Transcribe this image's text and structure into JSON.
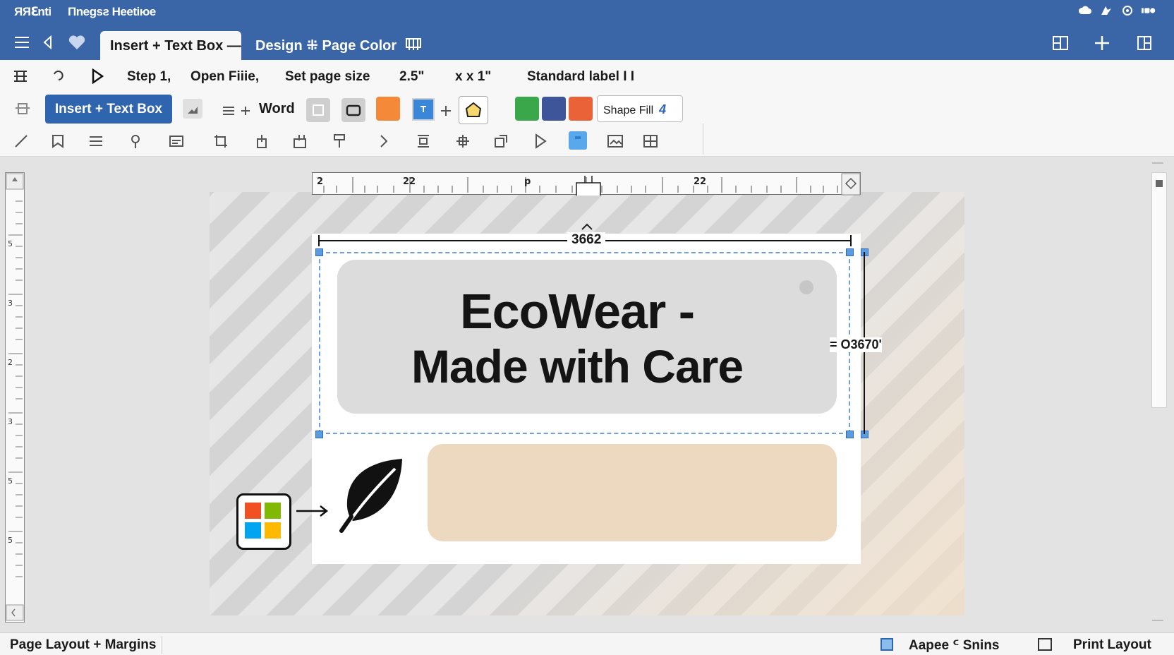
{
  "titlebar": {
    "app_name": "ЯЯℇnti",
    "document_title": "Πnegsƨ Heetiюe"
  },
  "tabs": [
    {
      "label": "Insert + Text Box —"
    },
    {
      "label": "Design ⁜ Page Color"
    }
  ],
  "steps": {
    "step1": "Step 1,",
    "step2": "Open Fiiie,",
    "step3": "Set page size",
    "size_w": "2.5\"",
    "size_h": "x x 1\"",
    "label_type": "Standard label I I"
  },
  "ribbon": {
    "insert_button": "Insert + Text Box",
    "word_label": "Word",
    "shape_fill_label": "Shape Fill",
    "shape_fill_value": "4",
    "colors": {
      "orange": "#f5893a",
      "blue": "#3a86d8",
      "green": "#3aa84a",
      "navy": "#3e5599",
      "red": "#ea6238"
    }
  },
  "ruler": {
    "marks": [
      "2",
      "22",
      "p",
      "22"
    ]
  },
  "label": {
    "headline_line1": "EcoWear -",
    "headline_line2": "Made with Care",
    "width_dim": "3662",
    "height_dim": "= O3670'"
  },
  "statusbar": {
    "left": "Page Layout + Margins",
    "mid": "Aapee ᑦ Snins",
    "view": "Print Layout"
  }
}
